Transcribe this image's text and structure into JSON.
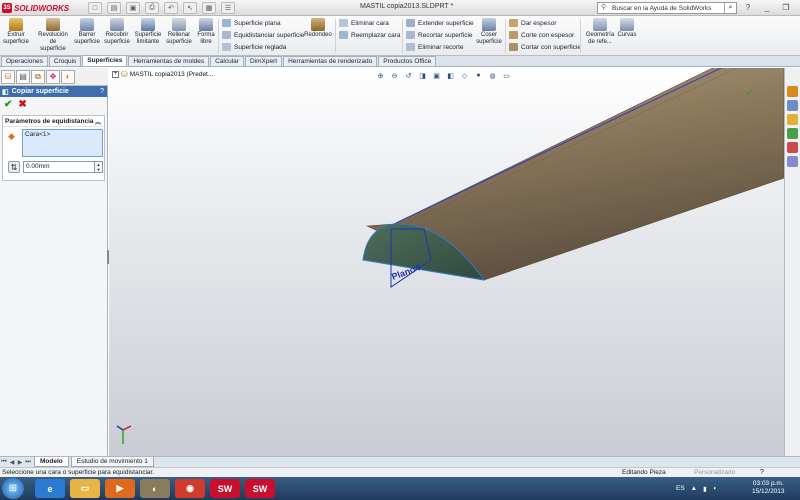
{
  "app": {
    "logo_text": "SOLIDWORKS",
    "window_title": "MASTIL copia2013.SLDPRT *",
    "help_search_placeholder": "Buscar en la Ayuda de SolidWorks"
  },
  "ribbon": {
    "big_buttons": [
      {
        "label": "Extruir superficie",
        "icon": "extrude-surface-icon"
      },
      {
        "label": "Revolución de superficie",
        "icon": "revolve-surface-icon"
      },
      {
        "label": "Barrer superficie",
        "icon": "sweep-surface-icon"
      },
      {
        "label": "Recubrir superficie",
        "icon": "loft-surface-icon"
      },
      {
        "label": "Superficie limitante",
        "icon": "boundary-surface-icon"
      },
      {
        "label": "Rellenar superficie",
        "icon": "fill-surface-icon"
      },
      {
        "label": "Forma libre",
        "icon": "freeform-icon"
      },
      {
        "label": "Redondeo",
        "icon": "fillet-icon"
      },
      {
        "label": "Coser superficie",
        "icon": "knit-surface-icon"
      },
      {
        "label": "Geometría de refe...",
        "icon": "reference-geometry-icon"
      },
      {
        "label": "Curvas",
        "icon": "curves-icon"
      }
    ],
    "small_buttons": [
      {
        "label": "Superficie plana",
        "icon": "planar-surface-icon"
      },
      {
        "label": "Equidistanciar superficie",
        "icon": "offset-surface-icon"
      },
      {
        "label": "Superficie reglada",
        "icon": "ruled-surface-icon"
      },
      {
        "label": "Eliminar cara",
        "icon": "delete-face-icon"
      },
      {
        "label": "Reemplazar cara",
        "icon": "replace-face-icon"
      },
      {
        "label": "Extender superficie",
        "icon": "extend-surface-icon"
      },
      {
        "label": "Recortar superficie",
        "icon": "trim-surface-icon"
      },
      {
        "label": "Eliminar recorte",
        "icon": "untrim-icon"
      },
      {
        "label": "Dar espesor",
        "icon": "thicken-icon"
      },
      {
        "label": "Corte con espesor",
        "icon": "thickened-cut-icon"
      },
      {
        "label": "Cortar con superficie",
        "icon": "surface-cut-icon"
      }
    ]
  },
  "tabs": [
    "Operaciones",
    "Croquis",
    "Superficies",
    "Herramientas de moldes",
    "Calcular",
    "DimXpert",
    "Herramientas de renderizado",
    "Productos Office"
  ],
  "property_manager": {
    "title": "Copiar superficie",
    "help": "?",
    "group_title": "Parámetros de equidistancia",
    "face_selection": "Cara<1>",
    "distance_value": "0.00mm"
  },
  "viewport": {
    "tree_item": "MASTIL copia2013  (Predet...",
    "plane_label": "Plano4"
  },
  "bottom_tabs": [
    "Modelo",
    "Estudio de movimiento 1"
  ],
  "status": {
    "message": "Seleccione una cara o superficie para equidistanciar.",
    "mode": "Editando Pieza",
    "custom": "Personalizado",
    "help": "?"
  },
  "taskbar": {
    "language": "ES",
    "time": "03:03 p.m.",
    "date": "15/12/2013",
    "apps": [
      {
        "name": "ie-icon",
        "color": "#2b7bd3",
        "label": "e"
      },
      {
        "name": "explorer-icon",
        "color": "#e8b444",
        "label": "▭"
      },
      {
        "name": "media-player-icon",
        "color": "#e06a1c",
        "label": "▶"
      },
      {
        "name": "gimp-icon",
        "color": "#8a7a5e",
        "label": "◐"
      },
      {
        "name": "chrome-icon",
        "color": "#d13a2c",
        "label": "◉"
      },
      {
        "name": "solidworks-taskbar-icon",
        "color": "#c8102e",
        "label": "SW"
      },
      {
        "name": "solidworks-taskbar-icon-2",
        "color": "#c8102e",
        "label": "SW"
      }
    ]
  }
}
